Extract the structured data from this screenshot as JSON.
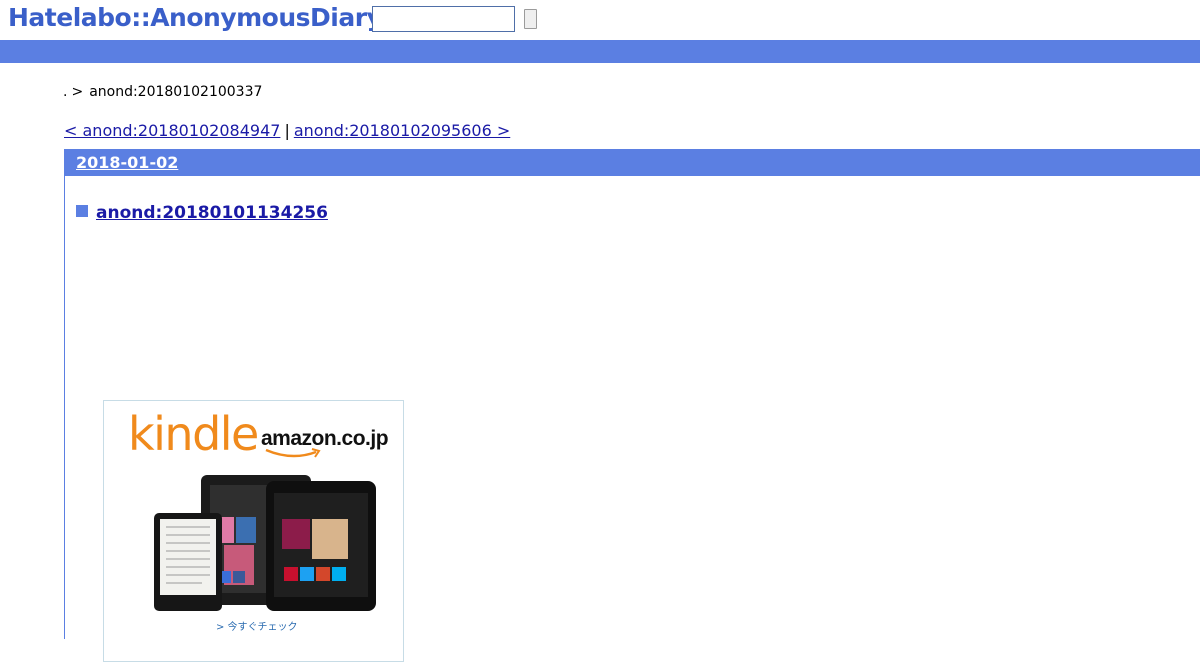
{
  "header": {
    "logo_text": "Hatelabo::AnonymousDiary",
    "search_value": "",
    "search_button_label": ""
  },
  "breadcrumb": {
    "prefix": ".",
    "separator": ">",
    "current": "anond:20180102100337"
  },
  "pager": {
    "prev_label": "< anond:20180102084947",
    "separator": "|",
    "next_label": "anond:20180102095606 >"
  },
  "day": {
    "date": "2018-01-02",
    "entry_title": "anond:20180101134256"
  },
  "ad": {
    "kindle_text": "kindle",
    "amazon_text": "amazon.co.jp",
    "cta_text": "> 今すぐチェック",
    "colors": {
      "kindle": "#f08a1c",
      "border": "#c7dce6"
    }
  },
  "colors": {
    "accent": "#5b7fe2",
    "logo": "#3a5fc9",
    "link": "#1a1aa6"
  }
}
